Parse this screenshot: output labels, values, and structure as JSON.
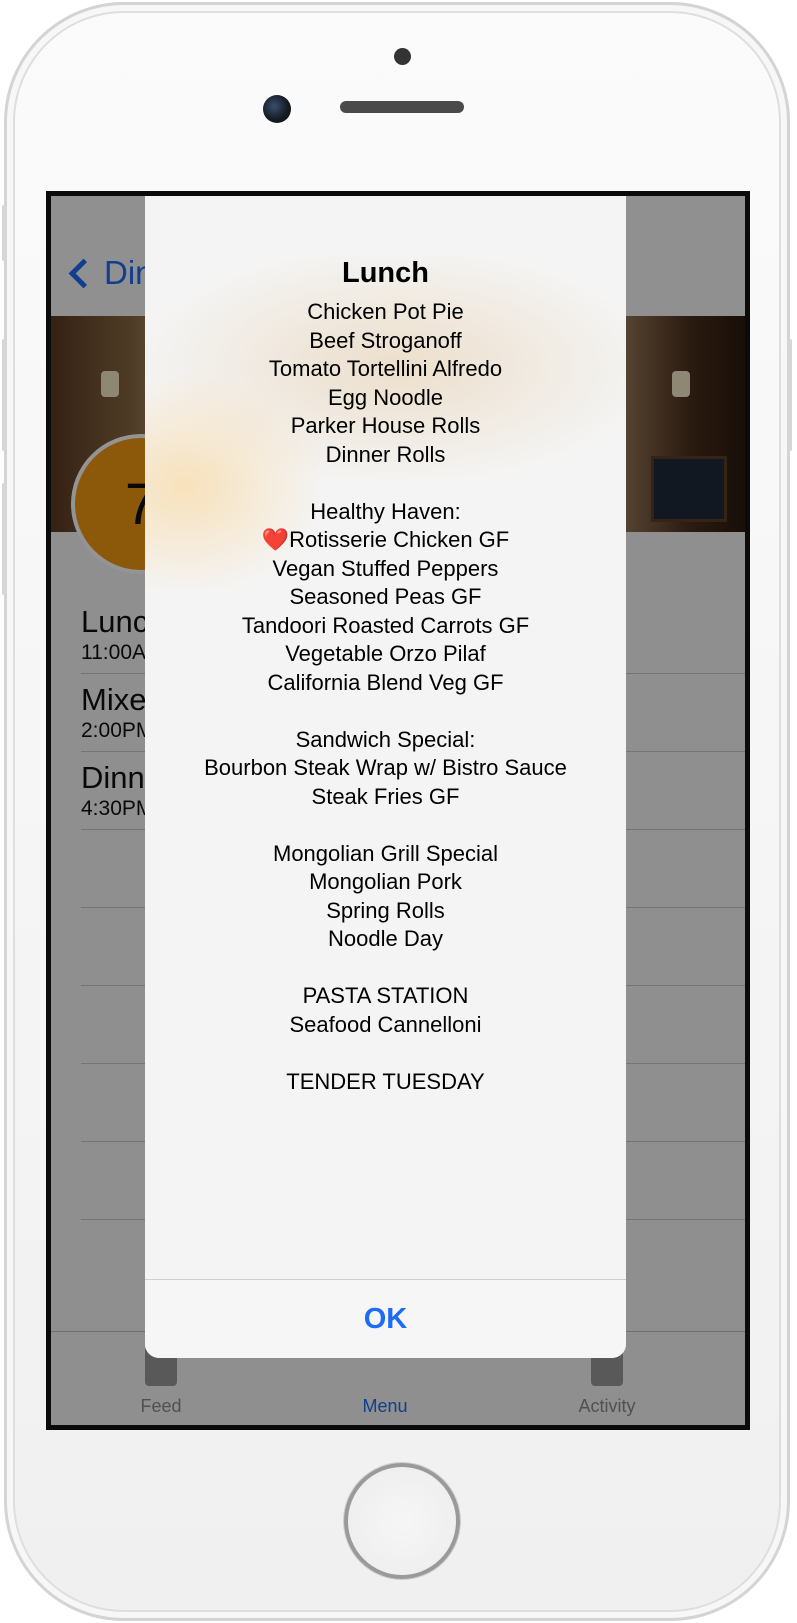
{
  "nav": {
    "back_label": "Din"
  },
  "header": {
    "counter": "7"
  },
  "meals": [
    {
      "name": "Lunc",
      "time": "11:00A"
    },
    {
      "name": "Mixe",
      "time": "2:00PM"
    },
    {
      "name": "Dinn",
      "time": "4:30PM"
    }
  ],
  "tabs": [
    {
      "label": "Feed",
      "icon": "feed-icon"
    },
    {
      "label": "Menu",
      "icon": "menu-icon"
    },
    {
      "label": "Activity",
      "icon": "activity-icon"
    }
  ],
  "alert": {
    "title": "Lunch",
    "lines": [
      "Chicken Pot Pie",
      "Beef Stroganoff",
      "Tomato Tortellini Alfredo",
      "Egg Noodle",
      "Parker House Rolls",
      "Dinner Rolls",
      "",
      "Healthy Haven:",
      "❤️Rotisserie Chicken GF",
      "Vegan Stuffed Peppers",
      "Seasoned Peas GF",
      "Tandoori Roasted Carrots GF",
      "Vegetable Orzo Pilaf",
      "California Blend Veg GF",
      "",
      "Sandwich Special:",
      "Bourbon Steak Wrap w/ Bistro Sauce",
      "Steak Fries GF",
      "",
      "Mongolian Grill Special",
      "Mongolian Pork",
      "Spring Rolls",
      "Noodle Day",
      "",
      "PASTA STATION",
      "Seafood Cannelloni",
      "",
      "TENDER TUESDAY"
    ],
    "ok_label": "OK"
  },
  "colors": {
    "accent": "#1e6cf5",
    "badge": "#f29a12"
  }
}
